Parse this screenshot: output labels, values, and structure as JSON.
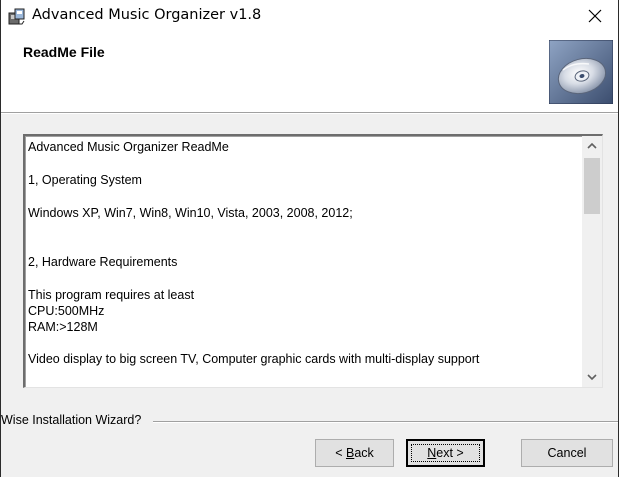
{
  "window": {
    "title": "Advanced Music Organizer v1.8",
    "close_glyph": "✕",
    "app_icon": "installer-icon"
  },
  "header": {
    "title": "ReadMe File",
    "graphic_icon": "cd-disc-icon"
  },
  "readme": {
    "lines": [
      "Advanced Music Organizer ReadMe",
      "1, Operating System",
      "Windows XP, Win7, Win8, Win10, Vista, 2003, 2008, 2012;",
      "2, Hardware Requirements",
      "This program requires at least",
      "CPU:500MHz",
      "RAM:>128M",
      "Video display to big screen TV, Computer graphic cards with multi-display support"
    ],
    "scroll_up_icon": "chevron-up-icon",
    "scroll_down_icon": "chevron-down-icon"
  },
  "footer": {
    "group_label": "Wise Installation Wizard?",
    "back_prefix": "< ",
    "back_mnemonic": "B",
    "back_rest": "ack",
    "next_mnemonic": "N",
    "next_rest": "ext >",
    "cancel_label": "Cancel"
  }
}
